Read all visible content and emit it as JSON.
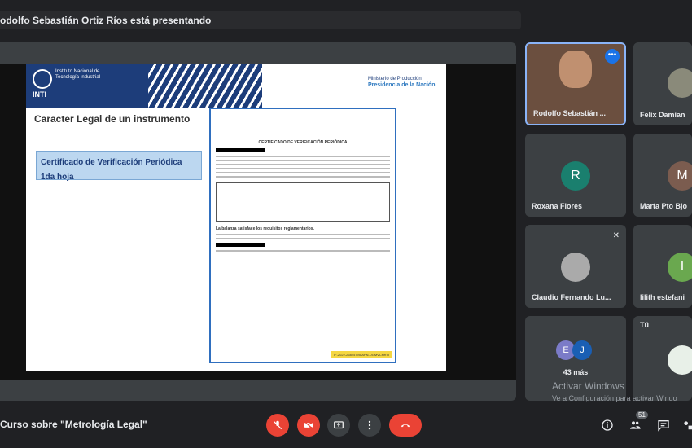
{
  "presenting_banner": "odolfo Sebastián Ortiz Ríos está presentando",
  "slide": {
    "inti_text": "Instituto Nacional de Tecnología Industrial",
    "inti_brand": "INTI",
    "gov_small": "Ministerio de Producción",
    "gov_big": "Presidencia de la Nación",
    "title": "Caracter Legal de un instrumento",
    "cert_line1": "Certificado de Verificación Periódica",
    "cert_line2": "1da hoja",
    "doc_title": "CERTIFICADO DE VERIFICACIÓN PERIÓDICA",
    "doc_tag": "IF-2022-26845795-APN-DGMVCHRTI",
    "doc_balance": "La balanza satisface los requisitos reglamentarios."
  },
  "participants": [
    {
      "name": "Rodolfo Sebastián ...",
      "initial": "",
      "color": "#6b4f3f",
      "active": true
    },
    {
      "name": "Felix Damian",
      "initial": "",
      "color": "#8a8a7a",
      "active": false
    },
    {
      "name": "Roxana Flores",
      "initial": "R",
      "color": "#1a7f6e",
      "active": false
    },
    {
      "name": "Marta Pto Bjo",
      "initial": "M",
      "color": "#7b5c4f",
      "active": false
    },
    {
      "name": "Claudio Fernando Lu...",
      "initial": "",
      "color": "#aaaaaa",
      "active": false
    },
    {
      "name": "lilith estefani",
      "initial": "I",
      "color": "#6aa84f",
      "active": false
    },
    {
      "name": "43 más",
      "initial": "",
      "color": "",
      "active": false
    },
    {
      "name": "Tú",
      "initial": "",
      "color": "",
      "active": false
    }
  ],
  "more_avatars": [
    "E",
    "J"
  ],
  "meeting_name": "Curso sobre \"Metrología Legal\"",
  "participants_count": "51",
  "watermark": {
    "line1": "Activar Windows",
    "line2": "Ve a Configuración para activar Windo"
  },
  "colors": {
    "end_call": "#ea4335",
    "mic_off": "#ea4335",
    "accent_blue": "#8ab4f8"
  }
}
